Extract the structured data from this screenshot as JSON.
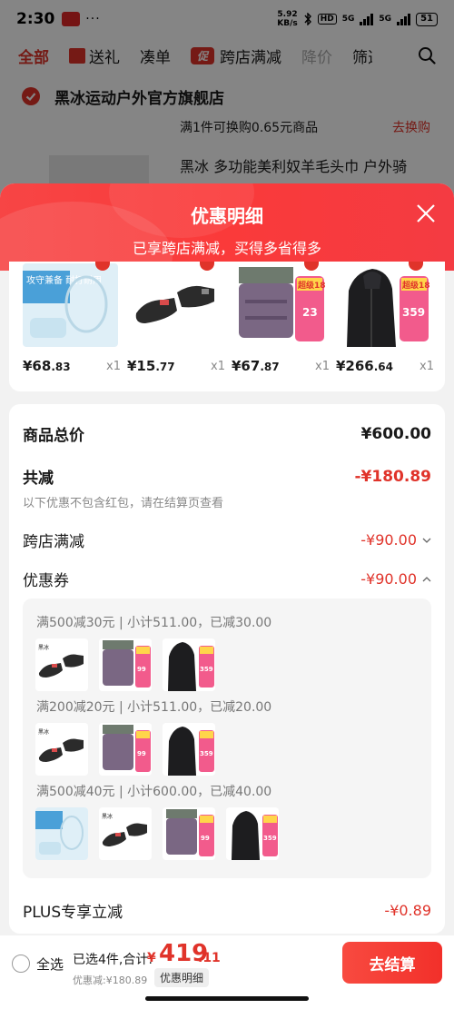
{
  "status_bar": {
    "time": "2:30",
    "dots": "···",
    "speed_top": "5.92",
    "speed_bottom": "KB/s",
    "hd": "HD",
    "net1": "5G",
    "net2": "5G",
    "battery": "51"
  },
  "tabs": [
    {
      "label": "全部"
    },
    {
      "label": "送礼"
    },
    {
      "label": "凑单"
    },
    {
      "label": "跨店满减",
      "badge": "促"
    },
    {
      "label": "降价"
    },
    {
      "label": "筛选"
    }
  ],
  "store": {
    "name": "黑冰运动户外官方旗舰店",
    "promo_text": "满1件可换购0.65元商品",
    "swap_link": "去换购",
    "product_name": "黑冰 多功能美利奴羊毛头巾 户外骑"
  },
  "sheet": {
    "title": "优惠明细",
    "subtitle": "已享跨店满减，买得多省得多"
  },
  "products": [
    {
      "price_int": "¥68",
      "price_dec": ".83",
      "qty": "x1",
      "img": "case",
      "img_text": "攻守兼备 耐打耐用"
    },
    {
      "price_int": "¥15",
      "price_dec": ".77",
      "qty": "x1",
      "img": "sock"
    },
    {
      "price_int": "¥67",
      "price_dec": ".87",
      "qty": "x1",
      "img": "scarf",
      "img_text": "超级18",
      "tag": "23"
    },
    {
      "price_int": "¥266",
      "price_dec": ".64",
      "qty": "x1",
      "img": "jacket",
      "img_text": "超级18",
      "tag": "359"
    }
  ],
  "summary": {
    "total_label": "商品总价",
    "total_value": "¥600.00",
    "reduce_label": "共减",
    "reduce_value": "-¥180.89",
    "note": "以下优惠不包含红包，请在结算页查看",
    "cross_label": "跨店满减",
    "cross_value": "-¥90.00",
    "coupon_label": "优惠券",
    "coupon_value": "-¥90.00",
    "plus_label": "PLUS专享立减",
    "plus_value": "-¥0.89"
  },
  "coupons": [
    {
      "title": "满500减30元 | 小计511.00，已减30.00",
      "items": [
        "sock",
        "scarf",
        "jacket"
      ]
    },
    {
      "title": "满200减20元 | 小计511.00，已减20.00",
      "items": [
        "sock",
        "scarf",
        "jacket"
      ]
    },
    {
      "title": "满500减40元 | 小计600.00，已减40.00",
      "items": [
        "case",
        "sock",
        "scarf",
        "jacket"
      ]
    }
  ],
  "mini_tags": {
    "sock": "23",
    "scarf": "99",
    "jacket": "359"
  },
  "footer": {
    "select_all": "全选",
    "selected": "已选4件,合计:",
    "total_symbol": "¥",
    "total_int": "419",
    "total_dec": ".11",
    "discount": "优惠减:¥180.89",
    "detail_tag": "优惠明细",
    "checkout": "去结算"
  },
  "colors": {
    "accent": "#e0332a",
    "header_red": "#fa3a3a"
  }
}
